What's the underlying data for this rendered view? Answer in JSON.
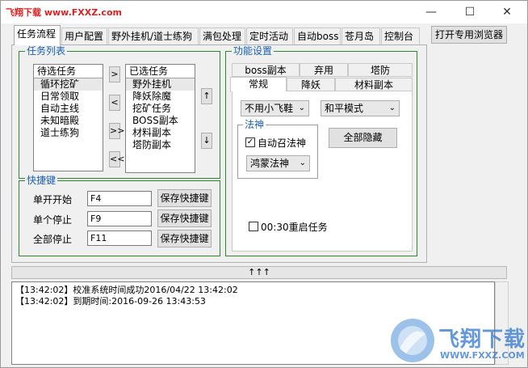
{
  "watermark_top": "飞翔下载 www.FXXZ.com",
  "window_buttons": {
    "minimize": "—",
    "maximize": "☐",
    "close": "✕"
  },
  "tabs": [
    {
      "label": "任务流程"
    },
    {
      "label": "用户配置"
    },
    {
      "label": "野外挂机/道士练狗"
    },
    {
      "label": "满包处理"
    },
    {
      "label": "定时活动"
    },
    {
      "label": "自动boss"
    },
    {
      "label": "苍月岛"
    },
    {
      "label": "控制台"
    }
  ],
  "browser_button": "打开专用浏览器",
  "task_list": {
    "group_title": "任务列表",
    "pending_header": "待选任务",
    "pending_items": [
      "循环挖矿",
      "日常领取",
      "自动主线",
      "未知暗殿",
      "道士练狗"
    ],
    "selected_header": "已选任务",
    "selected_items": [
      "野外挂机",
      "降妖除魔",
      "挖矿任务",
      "BOSS副本",
      "材料副本",
      "塔防副本"
    ],
    "move_buttons": [
      ">",
      "<",
      ">>",
      "<<"
    ],
    "order_up": "↑",
    "order_down": "↓"
  },
  "hotkeys": {
    "group_title": "快捷键",
    "rows": [
      {
        "label": "单开开始",
        "value": "F4",
        "button": "保存快捷键"
      },
      {
        "label": "单个停止",
        "value": "F9",
        "button": "保存快捷键"
      },
      {
        "label": "全部停止",
        "value": "F11",
        "button": "保存快捷键"
      }
    ]
  },
  "features": {
    "group_title": "功能设置",
    "subtabs_row1": [
      "boss副本",
      "弃用",
      "塔防"
    ],
    "subtabs_row2": [
      "常规",
      "降妖",
      "材料副本"
    ],
    "flyshoe_select": "不用小飞鞋",
    "mode_select": "和平模式",
    "fashen_title": "法神",
    "auto_summon_label": "自动召法神",
    "auto_summon_checked": "✓",
    "fashen_select": "鸿蒙法神",
    "hide_all_button": "全部隐藏",
    "restart_label": "00:30重启任务"
  },
  "divider_arrows": "↑↑↑",
  "log_lines": [
    "【13:42:02】校准系统时间成功2016/04/22 13:42:02",
    "【13:42:02】到期时间:2016-09-26 13:43:53"
  ],
  "watermark_brand": "飞翔下载",
  "watermark_url": "WWW.FXXZ.COM",
  "colors": {
    "group_border": "#2a8a2a",
    "group_title": "#1a5fb4",
    "watermark_red": "#e02020"
  }
}
